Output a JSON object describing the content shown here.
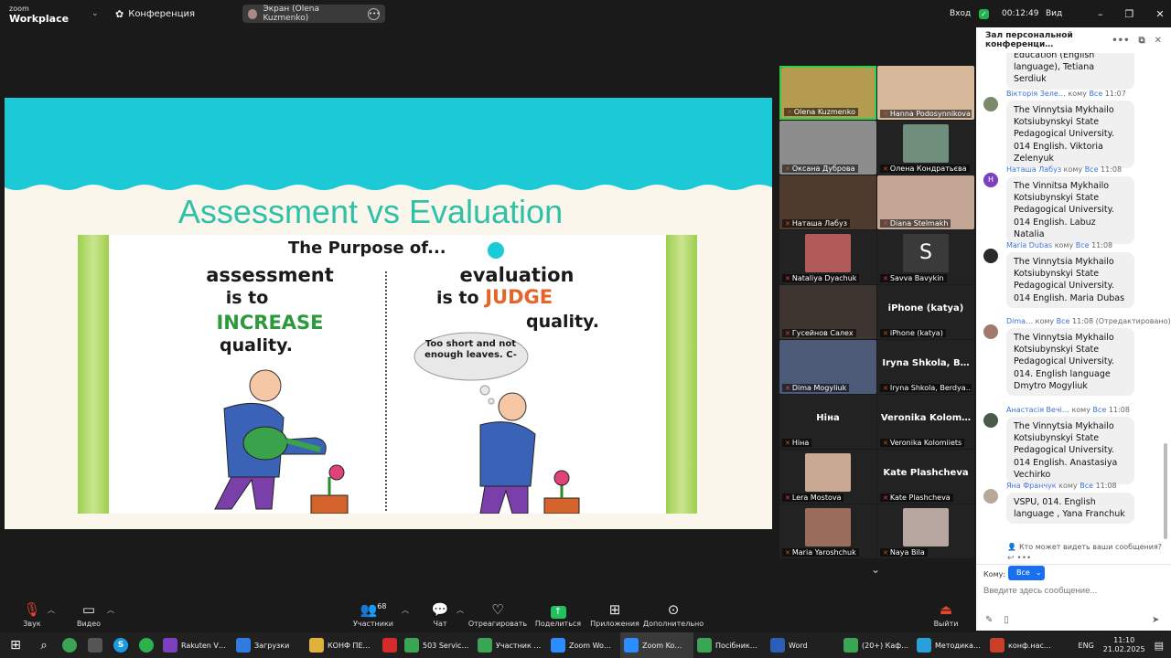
{
  "app": {
    "brand_line1": "zoom",
    "brand_line2": "Workplace",
    "conference_label": "Конференция"
  },
  "share": {
    "label": "Экран (Olena Kuzmenko)"
  },
  "top_right": {
    "signin": "Вход",
    "timer": "00:12:49",
    "view": "Вид"
  },
  "slide": {
    "title": "Assessment vs Evaluation",
    "heading": "The Purpose of...",
    "left_line1": "assessment",
    "left_line2": "is to",
    "left_line3": "INCREASE",
    "left_line4": "quality.",
    "right_line1": "evaluation",
    "right_line2a": "is to",
    "right_line2b": "JUDGE",
    "right_line3": "quality.",
    "thought": "Too short and not enough leaves. C-"
  },
  "gallery": [
    {
      "name": "Olena Kuzmenko",
      "big": "",
      "color": "#b59b4f"
    },
    {
      "name": "Hanna Podosynnikova",
      "big": "",
      "color": "#d8b89a"
    },
    {
      "name": "Оксана Дуброва",
      "big": "",
      "color": "#8d8d8d"
    },
    {
      "name": "Олена Кондратьєва",
      "big": "",
      "color": "#6f8f7c"
    },
    {
      "name": "Наташа Лабуз",
      "big": "",
      "color": "#4f3a2e"
    },
    {
      "name": "Diana Stelmakh",
      "big": "",
      "color": "#c4a694"
    },
    {
      "name": "Nataliya Dyachuk",
      "big": "",
      "color": "#b05a5a"
    },
    {
      "name": "Savva Bavykin",
      "big": "",
      "color": "#3a3a3a"
    },
    {
      "name": "Гусейнов Салех",
      "big": "",
      "color": "#3e3530"
    },
    {
      "name": "iPhone (katya)",
      "big": "iPhone (katya)",
      "color": ""
    },
    {
      "name": "Dima Mogyliuk",
      "big": "",
      "color": "#4c5a78"
    },
    {
      "name": "Iryna Shkola,  Berdya…",
      "big": "Iryna Shkola,  B…",
      "color": ""
    },
    {
      "name": "Ніна",
      "big": "Ніна",
      "color": ""
    },
    {
      "name": "Veronika Kolomiiets",
      "big": "Veronika  Kolom…",
      "color": ""
    },
    {
      "name": "Lera Mostova",
      "big": "",
      "color": "#c9a993"
    },
    {
      "name": "Kate Plashcheva",
      "big": "Kate Plashcheva",
      "color": ""
    },
    {
      "name": "Maria Yaroshchuk",
      "big": "",
      "color": "#9a6c5a"
    },
    {
      "name": "Naya Bila",
      "big": "",
      "color": "#b7a7a0"
    }
  ],
  "savva_initial": "S",
  "chat": {
    "title": "Зал персональной конференци…",
    "partial_text": "Education (English language), Tetiana Serdiuk",
    "to_word": "кому",
    "everyone": "Все",
    "messages": [
      {
        "who": "Вікторія Зеле…",
        "time": "11:07",
        "text": "The Vinnytsia Mykhailo Kotsiubynskyi State Pedagogical University. 014 English. Viktoria Zelenyuk",
        "avatar": "#7a8a6a",
        "initial": ""
      },
      {
        "who": "Наташа Лабуз",
        "time": "11:08",
        "text": "The Vinnitsa Mykhailo Kotsiubynskyi State Pedagogical University. 014 English. Labuz Natalia",
        "avatar": "#7b3fbf",
        "initial": "H"
      },
      {
        "who": "Maria Dubas",
        "time": "11:08",
        "text": "The Vinnytsia Mykhailo Kotsiubynskyi State Pedagogical University. 014 English. Maria Dubas",
        "avatar": "#2a2a2a",
        "initial": ""
      },
      {
        "who": "Dima…",
        "time": "11:08 (Отредактировано)",
        "text": "The Vinnytsia Mykhailo Kotsiubynskyi State Pedagogical University. 014. English language Dmytro Mogyliuk",
        "avatar": "#a07a6a",
        "initial": ""
      },
      {
        "who": "Анастасія Вечі…",
        "time": "11:08",
        "text": "The Vinnytsia Mykhailo Kotsiubynskyi State Pedagogical University. 014 English. Anastasiya Vechirko",
        "avatar": "#4a5a4a",
        "initial": ""
      },
      {
        "who": "Яна Франчук",
        "time": "11:08",
        "text": "VSPU, 014. English language , Yana Franchuk",
        "avatar": "#b8a89a",
        "initial": ""
      }
    ],
    "visibility_note": "Кто может видеть ваши сообщения?",
    "to_label": "Кому:",
    "to_value": "Все",
    "input_placeholder": "Введите здесь сообщение..."
  },
  "toolbar": {
    "audio": "Звук",
    "video": "Видео",
    "participants": "Участники",
    "participants_count": "68",
    "chat": "Чат",
    "react": "Отреагировать",
    "share": "Поделиться",
    "apps": "Приложения",
    "more": "Дополнительно",
    "leave": "Выйти"
  },
  "taskbar": {
    "items": [
      {
        "label": "Rakuten V…",
        "color": "#7b3fbf"
      },
      {
        "label": "Загрузки",
        "color": "#2f7be0"
      },
      {
        "label": "КОНФ ПЕ…",
        "color": "#e0b23a"
      },
      {
        "label": "",
        "color": "#d62b2b"
      },
      {
        "label": "503 Servic…",
        "color": "#3aa655"
      },
      {
        "label": "Участник …",
        "color": "#3aa655"
      },
      {
        "label": "Zoom Wo…",
        "color": "#2d8cff"
      },
      {
        "label": "Zoom Ko…",
        "color": "#2d8cff"
      },
      {
        "label": "Посібник…",
        "color": "#3aa655"
      },
      {
        "label": "Word",
        "color": "#2b5fb4"
      },
      {
        "label": "(20+) Каф…",
        "color": "#3aa655"
      },
      {
        "label": "Методика…",
        "color": "#2a9fd8"
      },
      {
        "label": "конф.нас…",
        "color": "#c8402a"
      }
    ],
    "lang": "ENG",
    "time": "11:10",
    "date": "21.02.2025"
  }
}
